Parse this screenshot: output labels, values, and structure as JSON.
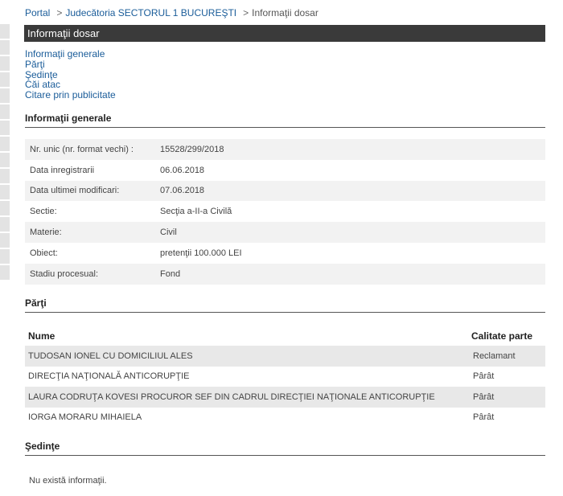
{
  "breadcrumb": {
    "portal": "Portal",
    "court": "Judecătoria SECTORUL 1 BUCUREŞTI",
    "current": "Informaţii dosar"
  },
  "title": "Informaţii dosar",
  "nav": [
    "Informaţii generale",
    "Părţi",
    "Şedinţe",
    "Căi atac",
    "Citare prin publicitate"
  ],
  "general": {
    "heading": "Informaţii generale",
    "rows": [
      {
        "label": "Nr. unic (nr. format vechi) :",
        "value": "15528/299/2018"
      },
      {
        "label": "Data inregistrarii",
        "value": "06.06.2018"
      },
      {
        "label": "Data ultimei modificari:",
        "value": "07.06.2018"
      },
      {
        "label": "Sectie:",
        "value": "Secţia a-II-a Civilă"
      },
      {
        "label": "Materie:",
        "value": "Civil"
      },
      {
        "label": "Obiect:",
        "value": "pretenţii 100.000 LEI"
      },
      {
        "label": "Stadiu procesual:",
        "value": "Fond"
      }
    ]
  },
  "parti": {
    "heading": "Părţi",
    "col_name": "Nume",
    "col_role": "Calitate parte",
    "rows": [
      {
        "name": "TUDOSAN IONEL CU DOMICILIUL ALES",
        "role": "Reclamant"
      },
      {
        "name": "DIRECŢIA NAŢIONALĂ ANTICORUPŢIE",
        "role": "Pârât"
      },
      {
        "name": "LAURA CODRUŢA KOVESI PROCUROR SEF DIN CADRUL DIRECŢIEI NAŢIONALE ANTICORUPŢIE",
        "role": "Pârât"
      },
      {
        "name": "IORGA MORARU MIHAIELA",
        "role": "Pârât"
      }
    ]
  },
  "sedinte": {
    "heading": "Şedinţe",
    "empty": "Nu există informaţii."
  }
}
